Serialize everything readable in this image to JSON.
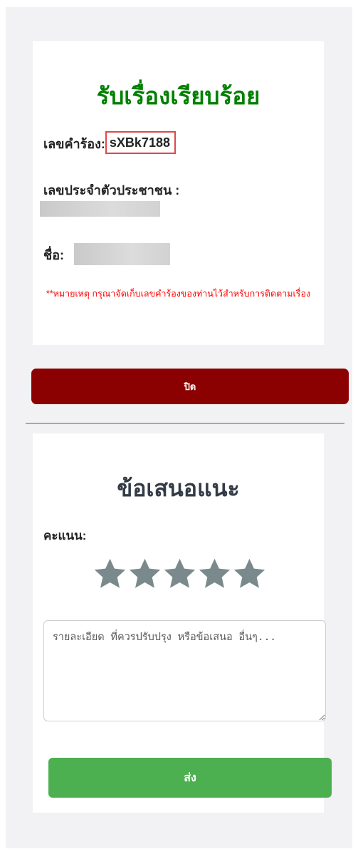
{
  "success_card": {
    "title": "รับเรื่องเรียบร้อย",
    "reference": {
      "label": "เลขคำร้อง:",
      "value": "sXBk7188",
      "highlight_color": "#e04848"
    },
    "citizen_id": {
      "label": "เลขประจำตัวประชาชน :"
    },
    "name": {
      "label": "ชื่อ:"
    },
    "note": "**หมายเหตุ กรุณาจัดเก็บเลขคำร้องของท่านไว้สำหรับการติดตามเรื่อง"
  },
  "close_button": {
    "label": "ปิด",
    "color": "#8b0000"
  },
  "feedback_card": {
    "title": "ข้อเสนอแนะ",
    "rating": {
      "label": "คะแนน:",
      "value": 0,
      "max": 5,
      "star_color": "#7a8a8c",
      "icon": "star-icon"
    },
    "textarea": {
      "placeholder": "รายละเอียด ที่ควรปรับปรุง หรือข้อเสนอ อื่นๆ...",
      "value": ""
    },
    "send_button": {
      "label": "ส่ง",
      "color": "#4caf50"
    }
  }
}
